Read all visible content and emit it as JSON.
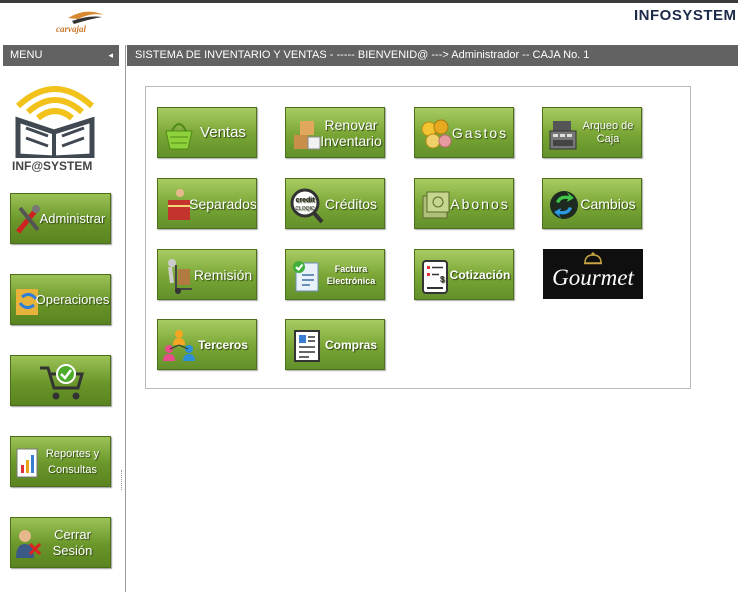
{
  "header": {
    "logo_text": "carvajal",
    "brand": "INFOSYSTEM"
  },
  "menu": {
    "label": "MENU",
    "collapse_icon": "◂"
  },
  "titlebar": {
    "text": "SISTEMA DE INVENTARIO Y VENTAS - ----- BIENVENID@ ---> Administrador -- CAJA No. 1"
  },
  "sidebar": {
    "logo_label": "INF@SYSTEM",
    "buttons": [
      {
        "label": "Administrar",
        "icon": "tools-icon"
      },
      {
        "label": "Operaciones",
        "icon": "folder-sync-icon"
      },
      {
        "label": "",
        "icon": "shopping-cart-icon"
      },
      {
        "label": "Reportes y Consultas",
        "icon": "report-chart-icon"
      },
      {
        "label": "Cerrar Sesión",
        "icon": "logout-user-icon"
      }
    ]
  },
  "modules": [
    {
      "label": "Ventas",
      "icon": "basket-icon"
    },
    {
      "label": "Renovar Inventario",
      "icon": "inventory-boxes-icon"
    },
    {
      "label": "Gastos",
      "icon": "coins-icon"
    },
    {
      "label": "Arqueo de Caja",
      "icon": "cash-register-icon"
    },
    {
      "label": "Separados",
      "icon": "reserved-package-icon"
    },
    {
      "label": "Créditos",
      "icon": "credit-magnifier-icon"
    },
    {
      "label": "Abonos",
      "icon": "money-bills-icon"
    },
    {
      "label": "Cambios",
      "icon": "exchange-arrows-icon"
    },
    {
      "label": "Remisión",
      "icon": "hand-truck-icon"
    },
    {
      "label": "Factura Electrónica",
      "icon": "electronic-invoice-icon"
    },
    {
      "label": "Cotización",
      "icon": "quotation-device-icon"
    },
    {
      "label": "Gourmet",
      "icon": "cloche-icon"
    },
    {
      "label": "Terceros",
      "icon": "people-network-icon"
    },
    {
      "label": "Compras",
      "icon": "purchase-document-icon"
    }
  ]
}
